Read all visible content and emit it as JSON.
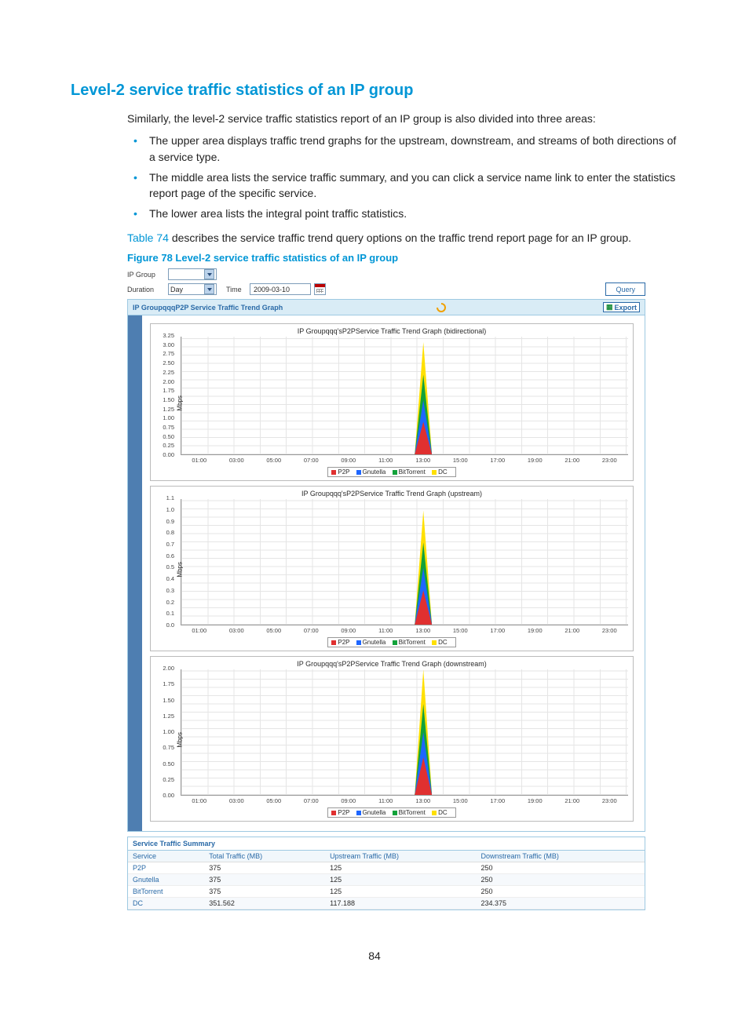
{
  "section_heading": "Level-2 service traffic statistics of an IP group",
  "intro_para": "Similarly, the level-2 service traffic statistics report of an IP group is also divided into three areas:",
  "bullets": [
    "The upper area displays traffic trend graphs for the upstream, downstream, and streams of both directions of a service type.",
    "The middle area lists the service traffic summary, and you can click a service name link to enter the statistics report page of the specific service.",
    "The lower area lists the integral point traffic statistics."
  ],
  "table_ref_prefix": "Table 74",
  "table_ref_rest": " describes the service traffic trend query options on the traffic trend report page for an IP group.",
  "figure_caption": "Figure 78 Level-2 service traffic statistics of an IP group",
  "page_number": "84",
  "ui": {
    "row1": {
      "label": "IP Group",
      "select_value": ""
    },
    "row2": {
      "label_duration": "Duration",
      "duration_value": "Day",
      "label_time": "Time",
      "time_value": "2009-03-10"
    },
    "query_btn": "Query",
    "panel_header": "IP GroupqqqP2P Service Traffic Trend Graph",
    "export_btn": "Export",
    "ylabel": "Mbps",
    "xticks": [
      "01:00",
      "03:00",
      "05:00",
      "07:00",
      "09:00",
      "11:00",
      "13:00",
      "15:00",
      "17:00",
      "19:00",
      "21:00",
      "23:00"
    ],
    "legend": {
      "p2p": "P2P",
      "gnu": "Gnutella",
      "bt": "BitTorrent",
      "dc": "DC"
    },
    "summary_header": "Service Traffic Summary",
    "summary_cols": {
      "srv": "Service",
      "total": "Total Traffic (MB)",
      "up": "Upstream Traffic (MB)",
      "down": "Downstream Traffic (MB)"
    }
  },
  "chart_data": [
    {
      "type": "area",
      "title": "IP Groupqqq'sP2PService Traffic Trend Graph (bidirectional)",
      "xlabel": "",
      "ylabel": "Mbps",
      "ylim": [
        0,
        3.25
      ],
      "yticks": [
        0.0,
        0.25,
        0.5,
        0.75,
        1.0,
        1.25,
        1.5,
        1.75,
        2.0,
        2.25,
        2.5,
        2.75,
        3.0,
        3.25
      ],
      "x": [
        "01:00",
        "03:00",
        "05:00",
        "07:00",
        "09:00",
        "11:00",
        "13:00",
        "15:00",
        "17:00",
        "19:00",
        "21:00",
        "23:00"
      ],
      "series": [
        {
          "name": "P2P",
          "color": "#e03030",
          "values": [
            0,
            0,
            0,
            0,
            0,
            0,
            0.9,
            0,
            0,
            0,
            0,
            0
          ]
        },
        {
          "name": "Gnutella",
          "color": "#1e66ff",
          "values": [
            0,
            0,
            0,
            0,
            0,
            0,
            1.5,
            0,
            0,
            0,
            0,
            0
          ]
        },
        {
          "name": "BitTorrent",
          "color": "#12a23a",
          "values": [
            0,
            0,
            0,
            0,
            0,
            0,
            2.2,
            0,
            0,
            0,
            0,
            0
          ]
        },
        {
          "name": "DC",
          "color": "#ffe000",
          "values": [
            0,
            0,
            0,
            0,
            0,
            0,
            3.1,
            0,
            0,
            0,
            0,
            0
          ]
        }
      ]
    },
    {
      "type": "area",
      "title": "IP Groupqqq'sP2PService Traffic Trend Graph (upstream)",
      "xlabel": "",
      "ylabel": "Mbps",
      "ylim": [
        0,
        1.1
      ],
      "yticks": [
        0.0,
        0.1,
        0.2,
        0.3,
        0.4,
        0.5,
        0.6,
        0.7,
        0.8,
        0.9,
        1.0,
        1.1
      ],
      "x": [
        "01:00",
        "03:00",
        "05:00",
        "07:00",
        "09:00",
        "11:00",
        "13:00",
        "15:00",
        "17:00",
        "19:00",
        "21:00",
        "23:00"
      ],
      "series": [
        {
          "name": "P2P",
          "color": "#e03030",
          "values": [
            0,
            0,
            0,
            0,
            0,
            0,
            0.3,
            0,
            0,
            0,
            0,
            0
          ]
        },
        {
          "name": "Gnutella",
          "color": "#1e66ff",
          "values": [
            0,
            0,
            0,
            0,
            0,
            0,
            0.5,
            0,
            0,
            0,
            0,
            0
          ]
        },
        {
          "name": "BitTorrent",
          "color": "#12a23a",
          "values": [
            0,
            0,
            0,
            0,
            0,
            0,
            0.72,
            0,
            0,
            0,
            0,
            0
          ]
        },
        {
          "name": "DC",
          "color": "#ffe000",
          "values": [
            0,
            0,
            0,
            0,
            0,
            0,
            1.0,
            0,
            0,
            0,
            0,
            0
          ]
        }
      ]
    },
    {
      "type": "area",
      "title": "IP Groupqqq'sP2PService Traffic Trend Graph (downstream)",
      "xlabel": "",
      "ylabel": "Mbps",
      "ylim": [
        0,
        2.0
      ],
      "yticks": [
        0.0,
        0.25,
        0.5,
        0.75,
        1.0,
        1.25,
        1.5,
        1.75,
        2.0
      ],
      "x": [
        "01:00",
        "03:00",
        "05:00",
        "07:00",
        "09:00",
        "11:00",
        "13:00",
        "15:00",
        "17:00",
        "19:00",
        "21:00",
        "23:00"
      ],
      "series": [
        {
          "name": "P2P",
          "color": "#e03030",
          "values": [
            0,
            0,
            0,
            0,
            0,
            0,
            0.6,
            0,
            0,
            0,
            0,
            0
          ]
        },
        {
          "name": "Gnutella",
          "color": "#1e66ff",
          "values": [
            0,
            0,
            0,
            0,
            0,
            0,
            1.0,
            0,
            0,
            0,
            0,
            0
          ]
        },
        {
          "name": "BitTorrent",
          "color": "#12a23a",
          "values": [
            0,
            0,
            0,
            0,
            0,
            0,
            1.45,
            0,
            0,
            0,
            0,
            0
          ]
        },
        {
          "name": "DC",
          "color": "#ffe000",
          "values": [
            0,
            0,
            0,
            0,
            0,
            0,
            2.0,
            0,
            0,
            0,
            0,
            0
          ]
        }
      ]
    }
  ],
  "summary_rows": [
    {
      "srv": "P2P",
      "total": "375",
      "up": "125",
      "down": "250"
    },
    {
      "srv": "Gnutella",
      "total": "375",
      "up": "125",
      "down": "250"
    },
    {
      "srv": "BitTorrent",
      "total": "375",
      "up": "125",
      "down": "250"
    },
    {
      "srv": "DC",
      "total": "351.562",
      "up": "117.188",
      "down": "234.375"
    }
  ],
  "colors": {
    "p2p": "#e03030",
    "gnu": "#1e66ff",
    "bt": "#12a23a",
    "dc": "#ffe000"
  }
}
